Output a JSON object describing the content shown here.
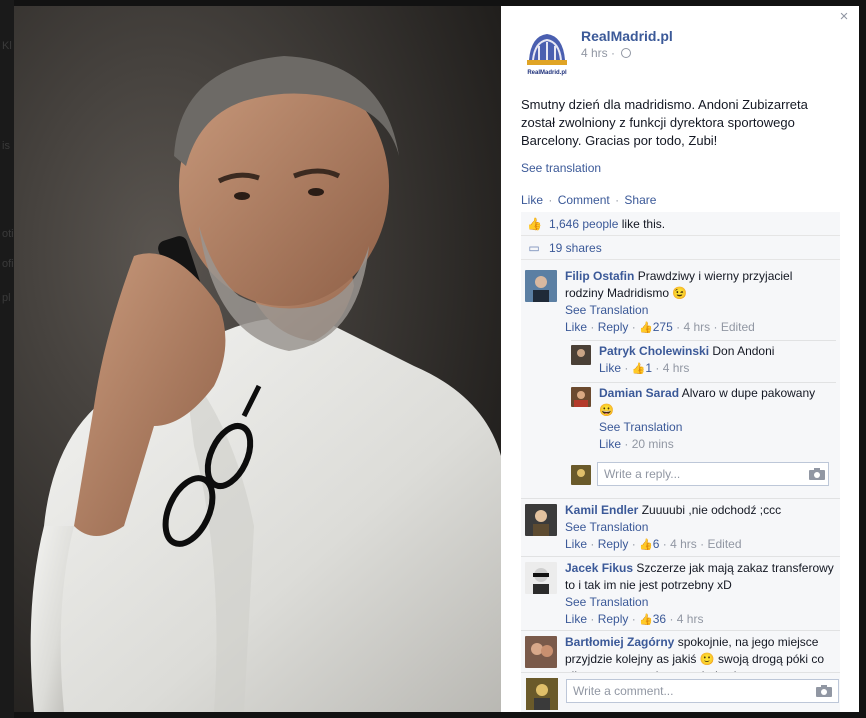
{
  "background": {
    "fragments": [
      "Kl",
      "is",
      "otic",
      "ofic",
      "pl"
    ]
  },
  "lightbox": {
    "close_glyph": "×"
  },
  "post": {
    "page_name": "RealMadrid.pl",
    "logo_text": "RealMadrid.pl",
    "time": "4 hrs",
    "privacy_icon": "globe-icon",
    "text": "Smutny dzień dla madridismo. Andoni Zubizarreta został zwolniony z funkcji dyrektora sportowego Barcelony. Gracias por todo, Zubi!",
    "see_translation": "See translation",
    "actions": {
      "like": "Like",
      "comment": "Comment",
      "share": "Share",
      "separator": "·"
    },
    "likes": {
      "count_text": "1,646 people",
      "suffix": "like this.",
      "icon": "thumbs-up-icon"
    },
    "shares": {
      "text": "19 shares",
      "icon": "share-icon"
    }
  },
  "comments": [
    {
      "name": "Filip Ostafin",
      "text": "Prawdziwy i wierny przyjaciel rodziny Madridismo",
      "emoji": "😉",
      "see_translation": "See Translation",
      "like": "Like",
      "reply": "Reply",
      "likes": "275",
      "time": "4 hrs",
      "edited": "Edited",
      "replies": [
        {
          "name": "Patryk Cholewinski",
          "text": "Don Andoni",
          "like": "Like",
          "likes": "1",
          "time": "4 hrs"
        },
        {
          "name": "Damian Sarad",
          "text": "Alvaro w dupe pakowany",
          "emoji": "😀",
          "see_translation": "See Translation",
          "like": "Like",
          "time": "20 mins"
        }
      ],
      "reply_placeholder": "Write a reply..."
    },
    {
      "name": "Kamil Endler",
      "text": "Zuuuubi ,nie odchodź ;ccc",
      "see_translation": "See Translation",
      "like": "Like",
      "reply": "Reply",
      "likes": "6",
      "time": "4 hrs",
      "edited": "Edited"
    },
    {
      "name": "Jacek Fikus",
      "text": "Szczerze jak mają zakaz transferowy to i tak im nie jest potrzebny xD",
      "see_translation": "See Translation",
      "like": "Like",
      "reply": "Reply",
      "likes": "36",
      "time": "4 hrs"
    },
    {
      "name": "Bartłomiej Zagórny",
      "text_a": "spokojnie, na jego miejsce przyjdzie kolejny as jakiś",
      "emoji": "🙂",
      "text_b": "swoją drogą póki co nikogo nowego nie potrzebują skoro"
    }
  ],
  "composer": {
    "placeholder": "Write a comment..."
  }
}
